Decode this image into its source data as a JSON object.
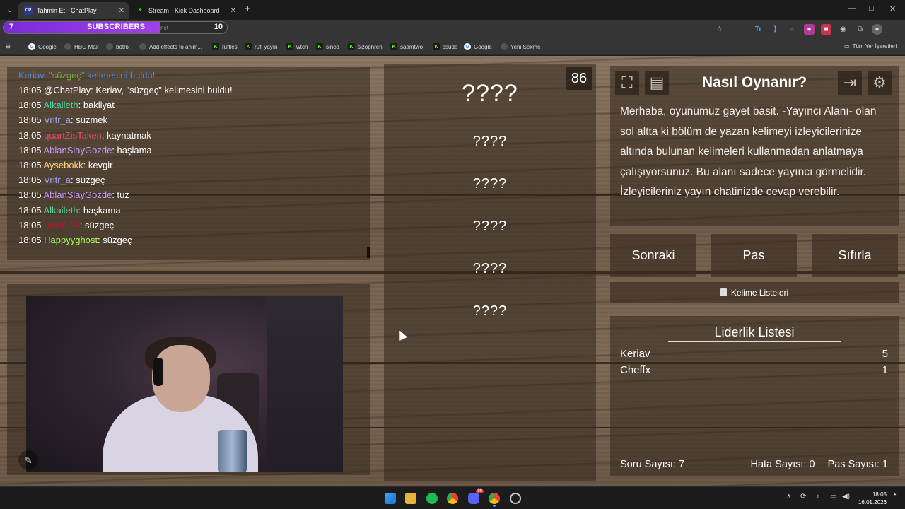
{
  "browser": {
    "tabs": [
      {
        "favicon": "CP",
        "title": "Tahmin Et - ChatPlay",
        "active": true
      },
      {
        "favicon": "K",
        "title": "Stream - Kick Dashboard",
        "active": false
      }
    ],
    "new_tab": "+",
    "window_controls": {
      "minimize": "—",
      "maximize": "□",
      "close": "✕"
    }
  },
  "sub_goal": {
    "current": "7",
    "label": "SUBSCRIBERS",
    "goal": "10",
    "progress": 0.7,
    "url_fragment": "net",
    "color": "#8b35e0"
  },
  "bookmarks": [
    {
      "icon": "google-icon",
      "label": "Google"
    },
    {
      "icon": "hbo-icon",
      "label": "HBO Max"
    },
    {
      "icon": "botrix-icon",
      "label": "botrix"
    },
    {
      "icon": "add-effects-icon",
      "label": "Add effects to anim..."
    },
    {
      "icon": "kick-icon",
      "label": "ruffles"
    },
    {
      "icon": "kick-icon",
      "label": "rufi yayın"
    },
    {
      "icon": "kick-icon",
      "label": "wtcn"
    },
    {
      "icon": "kick-icon",
      "label": "sinco"
    },
    {
      "icon": "kick-icon",
      "label": "sizophren"
    },
    {
      "icon": "kick-icon",
      "label": "saamtwo"
    },
    {
      "icon": "kick-icon",
      "label": "ssude"
    },
    {
      "icon": "google-icon",
      "label": "Google"
    },
    {
      "icon": "yeni-sekme-icon",
      "label": "Yeni Sekme"
    }
  ],
  "all_bookmarks": "Tüm Yer İşaretleri",
  "chat": {
    "top_line": {
      "user": "Keriav",
      "text": ", \"",
      "word": "süzgeç",
      "tail": "\" kelimesini buldu!"
    },
    "messages": [
      {
        "time": "18:05",
        "user": "@ChatPlay",
        "color": "#ffffff",
        "text": ": Keriav, \"süzgeç\" kelimesini buldu!"
      },
      {
        "time": "18:05",
        "user": "Alkaileth",
        "color": "#4fd9a0",
        "text": ": bakliyat"
      },
      {
        "time": "18:05",
        "user": "Vritr_a",
        "color": "#9aa6ff",
        "text": ": süzmek"
      },
      {
        "time": "18:05",
        "user": "quartZisTaken",
        "color": "#e04a6a",
        "text": ": kaynatmak"
      },
      {
        "time": "18:05",
        "user": "AblanSlayGozde",
        "color": "#c79cff",
        "text": ": haşlama"
      },
      {
        "time": "18:05",
        "user": "Aysebokk",
        "color": "#ffd479",
        "text": ": kevgir"
      },
      {
        "time": "18:05",
        "user": "Vritr_a",
        "color": "#9aa6ff",
        "text": ": süzgeç"
      },
      {
        "time": "18:05",
        "user": "AblanSlayGozde",
        "color": "#c79cff",
        "text": ": tuz"
      },
      {
        "time": "18:05",
        "user": "Alkaileth",
        "color": "#4fd9a0",
        "text": ": haşkama"
      },
      {
        "time": "18:05",
        "user": "emen.20",
        "color": "#c0142b",
        "text": ": süzgeç"
      },
      {
        "time": "18:05",
        "user": "Happyyghost",
        "color": "#a8ff5a",
        "text": ": süzgeç"
      }
    ]
  },
  "game": {
    "timer": "86",
    "main_word": "????",
    "hidden_words": [
      "????",
      "????",
      "????",
      "????",
      "????"
    ]
  },
  "how_to": {
    "title": "Nasıl Oynanır?",
    "text": "Merhaba, oyunumuz gayet basit. -Yayıncı Alanı- olan sol altta ki bölüm de yazan kelimeyi izleyicilerinize altında bulunan kelimeleri kullanmadan anlatmaya çalışıyorsunuz. Bu alanı sadece yayıncı görmelidir. İzleyicileriniz yayın chatinizde cevap verebilir."
  },
  "controls": {
    "next": "Sonraki",
    "pass": "Pas",
    "reset": "Sıfırla",
    "word_lists": "Kelime Listeleri"
  },
  "leaderboard": {
    "title": "Liderlik Listesi",
    "rows": [
      {
        "name": "Keriav",
        "score": "5"
      },
      {
        "name": "Cheffx",
        "score": "1"
      }
    ],
    "question_count": "Soru Sayısı: 7",
    "error_count": "Hata Sayısı: 0",
    "pass_count": "Pas Sayısı: 1"
  },
  "taskbar": {
    "time": "18:05",
    "date": "16.01.2026",
    "discord_badge": "99"
  }
}
